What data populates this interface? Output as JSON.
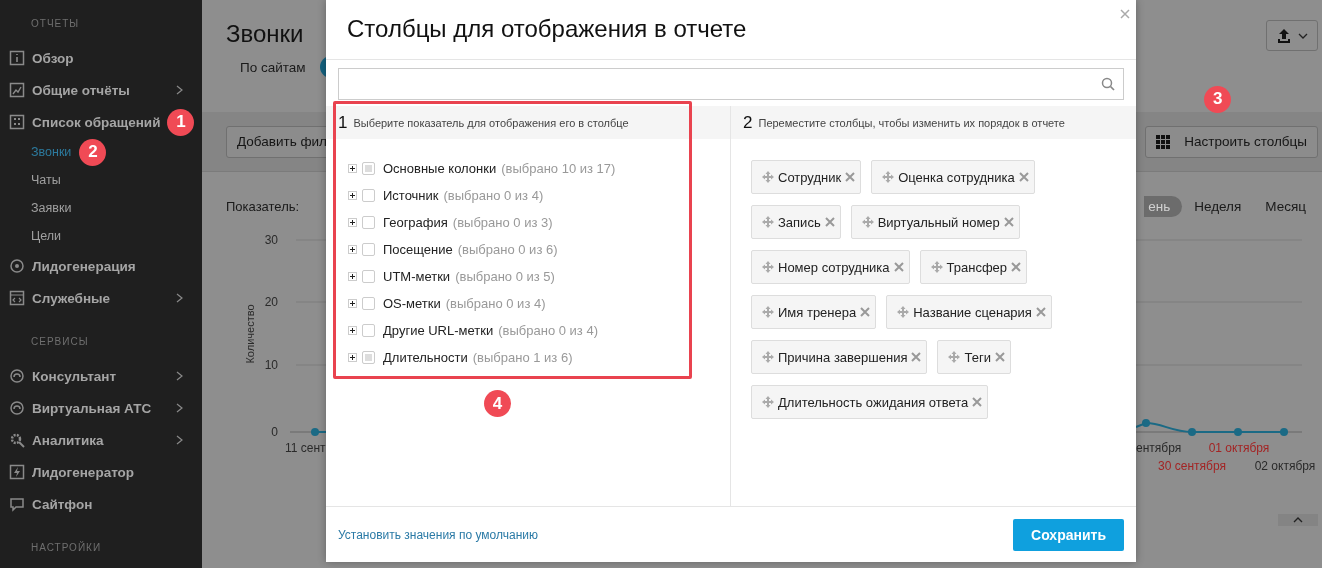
{
  "sidebar": {
    "sections": [
      {
        "header": "ОТЧЕТЫ",
        "items": [
          {
            "label": "Обзор",
            "has_submenu": false
          },
          {
            "label": "Общие отчёты",
            "has_submenu": true
          },
          {
            "label": "Список обращений",
            "has_submenu": false,
            "callout": "1",
            "children": [
              {
                "label": "Звонки",
                "selected": true,
                "callout": "2"
              },
              {
                "label": "Чаты",
                "selected": false
              },
              {
                "label": "Заявки",
                "selected": false
              },
              {
                "label": "Цели",
                "selected": false
              }
            ]
          },
          {
            "label": "Лидогенерация",
            "has_submenu": false
          },
          {
            "label": "Служебные",
            "has_submenu": true
          }
        ]
      },
      {
        "header": "СЕРВИСЫ",
        "items": [
          {
            "label": "Консультант",
            "has_submenu": true
          },
          {
            "label": "Виртуальная АТС",
            "has_submenu": true
          },
          {
            "label": "Аналитика",
            "has_submenu": true
          },
          {
            "label": "Лидогенератор",
            "has_submenu": false
          },
          {
            "label": "Сайтфон",
            "has_submenu": false
          }
        ]
      },
      {
        "header": "НАСТРОЙКИ"
      }
    ]
  },
  "page": {
    "title": "Звонки",
    "site_filter_label": "По сайтам",
    "site_filter_on": true,
    "add_filter_button": "Добавить фил",
    "columns_button": {
      "label": "Настроить столбцы",
      "callout": "3"
    },
    "metric_label": "Показатель:",
    "periods": [
      {
        "label": "ень",
        "selected": true
      },
      {
        "label": "Неделя",
        "selected": false
      },
      {
        "label": "Месяц",
        "selected": false
      }
    ],
    "chart": {
      "y_title": "Количество",
      "y_ticks": [
        "30",
        "20",
        "10",
        "0"
      ],
      "x_labels": [
        {
          "text": "11 сент",
          "weekend": false
        },
        {
          "text": "ентября",
          "weekend": false
        },
        {
          "text": "01 октября",
          "weekend": true
        },
        {
          "text": "30 сентября",
          "weekend": true
        },
        {
          "text": "02 октября",
          "weekend": false
        }
      ]
    }
  },
  "dialog": {
    "title": "Столбцы для отображения в отчете",
    "left_panel": {
      "step": "1",
      "hint": "Выберите показатель для отображения его в столбце",
      "callout": "4",
      "groups": [
        {
          "name": "Основные колонки",
          "count": "(выбрано 10 из 17)",
          "partial": true,
          "expanded": false
        },
        {
          "name": "Источник",
          "count": "(выбрано 0 из 4)",
          "partial": false,
          "expanded": false
        },
        {
          "name": "География",
          "count": "(выбрано 0 из 3)",
          "partial": false,
          "expanded": false
        },
        {
          "name": "Посещение",
          "count": "(выбрано 0 из 6)",
          "partial": false,
          "expanded": false
        },
        {
          "name": "UTM-метки",
          "count": "(выбрано 0 из 5)",
          "partial": false,
          "expanded": false
        },
        {
          "name": "OS-метки",
          "count": "(выбрано 0 из 4)",
          "partial": false,
          "expanded": false
        },
        {
          "name": "Другие URL-метки",
          "count": "(выбрано 0 из 4)",
          "partial": false,
          "expanded": false
        },
        {
          "name": "Длительности",
          "count": "(выбрано 1 из 6)",
          "partial": true,
          "expanded": false
        }
      ]
    },
    "right_panel": {
      "step": "2",
      "hint": "Переместите столбцы, чтобы изменить их порядок в отчете",
      "columns": [
        "Сотрудник",
        "Оценка сотрудника",
        "Запись",
        "Виртуальный номер",
        "Номер сотрудника",
        "Трансфер",
        "Имя тренера",
        "Название сценария",
        "Причина завершения",
        "Теги",
        "Длительность ожидания ответа"
      ]
    },
    "reset_link": "Установить значения по умолчанию",
    "save_button": "Сохранить"
  }
}
